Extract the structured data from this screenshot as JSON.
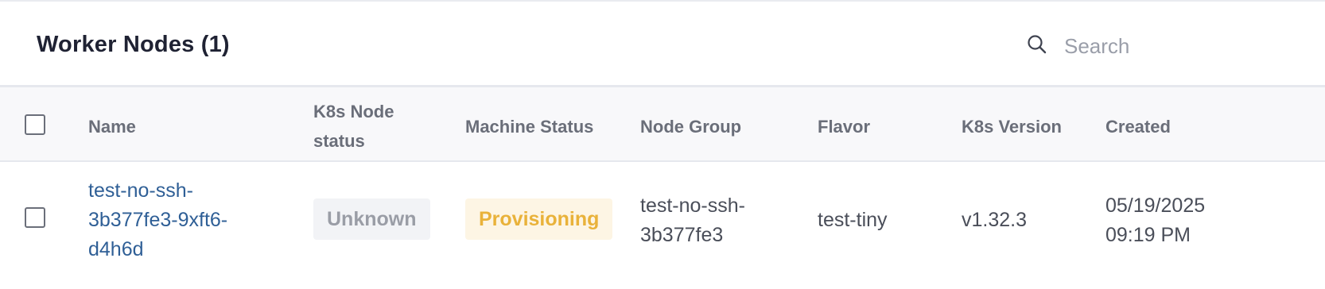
{
  "header": {
    "title": "Worker Nodes (1)",
    "search": {
      "placeholder": "Search",
      "value": ""
    },
    "icons": {
      "search": "search-icon"
    }
  },
  "table": {
    "columns": {
      "name": "Name",
      "k8s_node_status_line1": "K8s Node",
      "k8s_node_status_line2": "status",
      "machine_status": "Machine Status",
      "node_group": "Node Group",
      "flavor": "Flavor",
      "k8s_version": "K8s Version",
      "created": "Created"
    },
    "rows": [
      {
        "name_line1": "test-no-ssh-",
        "name_line2": "3b377fe3-9xft6-",
        "name_line3": "d4h6d",
        "k8s_node_status": "Unknown",
        "machine_status": "Provisioning",
        "node_group_line1": "test-no-ssh-",
        "node_group_line2": "3b377fe3",
        "flavor": "test-tiny",
        "k8s_version": "v1.32.3",
        "created_line1": "05/19/2025",
        "created_line2": "09:19 PM",
        "selected": false
      }
    ]
  },
  "colors": {
    "link": "#2f5f96",
    "unknown_badge_bg": "#f2f3f6",
    "unknown_badge_text": "#9a9da6",
    "provisioning_badge_bg": "#fdf5e4",
    "provisioning_badge_text": "#e9b23a"
  }
}
